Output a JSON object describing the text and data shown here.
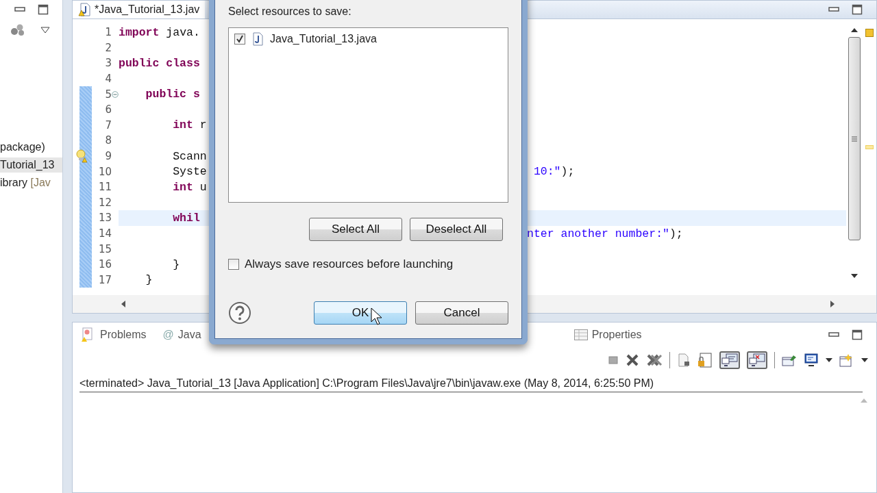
{
  "explorer": {
    "items": [
      {
        "text": "package)",
        "selected": false
      },
      {
        "text": "Tutorial_13",
        "selected": true
      },
      {
        "text": "ibrary",
        "decoration": "[Jav",
        "selected": false
      }
    ]
  },
  "editor": {
    "tab": {
      "title": "*Java_Tutorial_13.jav"
    },
    "lines": [
      {
        "number": "1",
        "changed": false,
        "current": false,
        "warning": false,
        "fold": false,
        "left": [
          {
            "kind": "keyword",
            "text": "import"
          },
          {
            "kind": "plain",
            "text": " java."
          }
        ]
      },
      {
        "number": "2",
        "changed": false,
        "current": false,
        "warning": false,
        "fold": false
      },
      {
        "number": "3",
        "changed": false,
        "current": false,
        "warning": false,
        "fold": false,
        "left": [
          {
            "kind": "keyword",
            "text": "public class"
          }
        ]
      },
      {
        "number": "4",
        "changed": false,
        "current": false,
        "warning": false,
        "fold": false
      },
      {
        "number": "5",
        "changed": true,
        "current": false,
        "warning": false,
        "fold": true,
        "left": [
          {
            "kind": "keyword",
            "text": "    public s"
          }
        ]
      },
      {
        "number": "6",
        "changed": true,
        "current": false,
        "warning": false,
        "fold": false
      },
      {
        "number": "7",
        "changed": true,
        "current": false,
        "warning": false,
        "fold": false,
        "left": [
          {
            "kind": "keyword",
            "text": "        int"
          },
          {
            "kind": "plain",
            "text": " r"
          }
        ]
      },
      {
        "number": "8",
        "changed": true,
        "current": false,
        "warning": false,
        "fold": false
      },
      {
        "number": "9",
        "changed": true,
        "current": false,
        "warning": true,
        "fold": false,
        "left": [
          {
            "kind": "plain",
            "text": "        Scann"
          }
        ]
      },
      {
        "number": "10",
        "changed": true,
        "current": false,
        "warning": false,
        "fold": false,
        "left": [
          {
            "kind": "plain",
            "text": "        Syste"
          }
        ],
        "right": [
          {
            "kind": "string",
            "text": " 10:\""
          },
          {
            "kind": "plain",
            "text": ");"
          }
        ]
      },
      {
        "number": "11",
        "changed": true,
        "current": false,
        "warning": false,
        "fold": false,
        "left": [
          {
            "kind": "keyword",
            "text": "        int"
          },
          {
            "kind": "plain",
            "text": " u"
          }
        ]
      },
      {
        "number": "12",
        "changed": true,
        "current": false,
        "warning": false,
        "fold": false
      },
      {
        "number": "13",
        "changed": true,
        "current": true,
        "warning": false,
        "fold": false,
        "left": [
          {
            "kind": "keyword",
            "text": "        whil"
          }
        ]
      },
      {
        "number": "14",
        "changed": true,
        "current": false,
        "warning": false,
        "fold": false,
        "right": [
          {
            "kind": "string",
            "text": "nter another number:\""
          },
          {
            "kind": "plain",
            "text": ");"
          }
        ]
      },
      {
        "number": "15",
        "changed": true,
        "current": false,
        "warning": false,
        "fold": false
      },
      {
        "number": "16",
        "changed": true,
        "current": false,
        "warning": false,
        "fold": false,
        "left": [
          {
            "kind": "plain",
            "text": "        }"
          }
        ]
      },
      {
        "number": "17",
        "changed": true,
        "current": false,
        "warning": false,
        "fold": false,
        "left": [
          {
            "kind": "plain",
            "text": "    }"
          }
        ]
      }
    ]
  },
  "bottom_panel": {
    "tabs": [
      {
        "label": "Problems",
        "selected": false
      },
      {
        "label": "Java",
        "icon_char": "@",
        "selected": false
      },
      {
        "label": "Properties",
        "selected": false
      }
    ],
    "console_header": "<terminated> Java_Tutorial_13 [Java Application] C:\\Program Files\\Java\\jre7\\bin\\javaw.exe (May 8, 2014, 6:25:50 PM)"
  },
  "dialog": {
    "prompt": "Select resources to save:",
    "resources": [
      {
        "name": "Java_Tutorial_13.java",
        "checked": true
      }
    ],
    "list_buttons": [
      "Select All",
      "Deselect All"
    ],
    "always_save": {
      "label": "Always save resources before launching",
      "checked": false
    },
    "ok": "OK",
    "cancel": "Cancel"
  }
}
